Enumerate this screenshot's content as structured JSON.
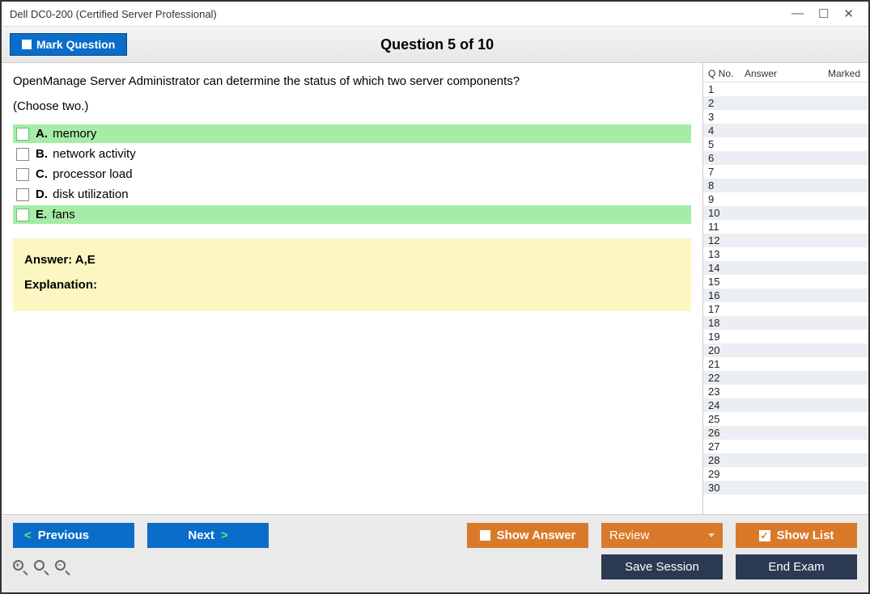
{
  "window": {
    "title": "Dell DC0-200 (Certified Server Professional)"
  },
  "header": {
    "mark_label": "Mark Question",
    "question_title": "Question 5 of 10"
  },
  "question": {
    "text": "OpenManage Server Administrator can determine the status of which two server components?",
    "subtext": "(Choose two.)",
    "options": [
      {
        "letter": "A.",
        "text": "memory",
        "correct": true
      },
      {
        "letter": "B.",
        "text": "network activity",
        "correct": false
      },
      {
        "letter": "C.",
        "text": "processor load",
        "correct": false
      },
      {
        "letter": "D.",
        "text": "disk utilization",
        "correct": false
      },
      {
        "letter": "E.",
        "text": "fans",
        "correct": true
      }
    ]
  },
  "answer": {
    "line": "Answer: A,E",
    "explanation_label": "Explanation:"
  },
  "side": {
    "head": {
      "qno": "Q No.",
      "answer": "Answer",
      "marked": "Marked"
    },
    "rows": [
      1,
      2,
      3,
      4,
      5,
      6,
      7,
      8,
      9,
      10,
      11,
      12,
      13,
      14,
      15,
      16,
      17,
      18,
      19,
      20,
      21,
      22,
      23,
      24,
      25,
      26,
      27,
      28,
      29,
      30
    ]
  },
  "footer": {
    "previous": "Previous",
    "next": "Next",
    "show_answer": "Show Answer",
    "review": "Review",
    "show_list": "Show List",
    "save_session": "Save Session",
    "end_exam": "End Exam"
  }
}
